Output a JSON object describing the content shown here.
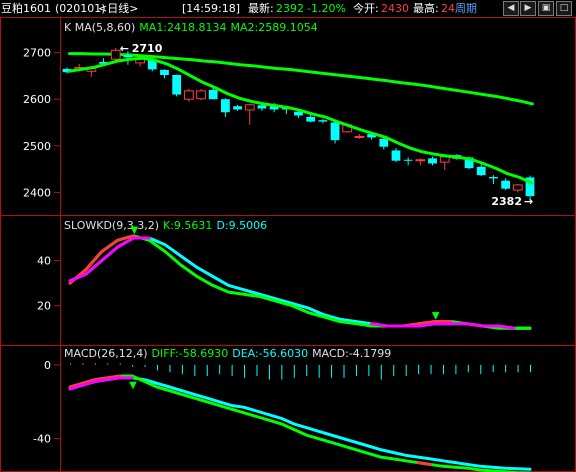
{
  "header": {
    "symbol": "豆粕1601",
    "code": "(020101)",
    "period": "<日线>",
    "time": "[14:59:18]",
    "last_label": "最新:",
    "last_value": "2392",
    "change_pct": "-1.20%",
    "open_label": "今开:",
    "open_value": "2430",
    "high_label": "最高:",
    "high_value": "24",
    "period_button": "周期",
    "icons": [
      "arrow-left-icon",
      "arrow-right-icon",
      "window-icon",
      "maximize-icon"
    ]
  },
  "colors": {
    "background": "#000000",
    "frame": "#b01010",
    "up": "#ff3c3c",
    "down": "#00ffff",
    "ma": "#00ff00",
    "white": "#ffffff",
    "magenta": "#ff00ff",
    "yellow": "#ffff00",
    "axis_text": "#ffffff",
    "title_white": "#e0e0e0",
    "green_text": "#00ff00",
    "cyan_text": "#00ffff"
  },
  "chart_data": [
    {
      "type": "candlestick",
      "title": "K  MA(5,8,60)",
      "legend": [
        {
          "label": "MA1:2418.8134",
          "color": "#00ff00"
        },
        {
          "label": "MA2:2589.1054",
          "color": "#00ff00"
        }
      ],
      "ylim": [
        2360,
        2740
      ],
      "yticks": [
        2400,
        2500,
        2600,
        2700
      ],
      "high_marker": {
        "label": "2710",
        "value": 2710
      },
      "low_marker": {
        "label": "2382",
        "value": 2382
      },
      "candles": [
        {
          "o": 2665,
          "h": 2668,
          "l": 2655,
          "c": 2658
        },
        {
          "o": 2665,
          "h": 2676,
          "l": 2660,
          "c": 2668
        },
        {
          "o": 2660,
          "h": 2672,
          "l": 2648,
          "c": 2667
        },
        {
          "o": 2680,
          "h": 2688,
          "l": 2672,
          "c": 2676
        },
        {
          "o": 2686,
          "h": 2710,
          "l": 2680,
          "c": 2705
        },
        {
          "o": 2694,
          "h": 2703,
          "l": 2674,
          "c": 2690
        },
        {
          "o": 2678,
          "h": 2690,
          "l": 2670,
          "c": 2686
        },
        {
          "o": 2685,
          "h": 2688,
          "l": 2660,
          "c": 2664
        },
        {
          "o": 2663,
          "h": 2664,
          "l": 2645,
          "c": 2652
        },
        {
          "o": 2652,
          "h": 2653,
          "l": 2606,
          "c": 2610
        },
        {
          "o": 2600,
          "h": 2622,
          "l": 2595,
          "c": 2618
        },
        {
          "o": 2601,
          "h": 2622,
          "l": 2598,
          "c": 2618
        },
        {
          "o": 2620,
          "h": 2625,
          "l": 2600,
          "c": 2600
        },
        {
          "o": 2600,
          "h": 2602,
          "l": 2562,
          "c": 2572
        },
        {
          "o": 2585,
          "h": 2588,
          "l": 2575,
          "c": 2578
        },
        {
          "o": 2577,
          "h": 2590,
          "l": 2545,
          "c": 2588
        },
        {
          "o": 2587,
          "h": 2590,
          "l": 2575,
          "c": 2580
        },
        {
          "o": 2585,
          "h": 2592,
          "l": 2572,
          "c": 2578
        },
        {
          "o": 2582,
          "h": 2585,
          "l": 2568,
          "c": 2578
        },
        {
          "o": 2573,
          "h": 2580,
          "l": 2560,
          "c": 2565
        },
        {
          "o": 2562,
          "h": 2566,
          "l": 2550,
          "c": 2552
        },
        {
          "o": 2555,
          "h": 2558,
          "l": 2548,
          "c": 2552
        },
        {
          "o": 2550,
          "h": 2555,
          "l": 2505,
          "c": 2512
        },
        {
          "o": 2530,
          "h": 2548,
          "l": 2528,
          "c": 2545
        },
        {
          "o": 2518,
          "h": 2525,
          "l": 2515,
          "c": 2520
        },
        {
          "o": 2525,
          "h": 2527,
          "l": 2513,
          "c": 2518
        },
        {
          "o": 2515,
          "h": 2518,
          "l": 2492,
          "c": 2498
        },
        {
          "o": 2490,
          "h": 2495,
          "l": 2465,
          "c": 2468
        },
        {
          "o": 2470,
          "h": 2475,
          "l": 2458,
          "c": 2468
        },
        {
          "o": 2470,
          "h": 2473,
          "l": 2458,
          "c": 2470
        },
        {
          "o": 2473,
          "h": 2477,
          "l": 2458,
          "c": 2462
        },
        {
          "o": 2465,
          "h": 2478,
          "l": 2448,
          "c": 2476
        },
        {
          "o": 2480,
          "h": 2482,
          "l": 2470,
          "c": 2472
        },
        {
          "o": 2475,
          "h": 2477,
          "l": 2450,
          "c": 2452
        },
        {
          "o": 2455,
          "h": 2460,
          "l": 2435,
          "c": 2437
        },
        {
          "o": 2433,
          "h": 2437,
          "l": 2418,
          "c": 2430
        },
        {
          "o": 2425,
          "h": 2430,
          "l": 2405,
          "c": 2408
        },
        {
          "o": 2405,
          "h": 2418,
          "l": 2400,
          "c": 2416
        },
        {
          "o": 2432,
          "h": 2436,
          "l": 2382,
          "c": 2392
        }
      ],
      "ma_fast": [
        2660,
        2664,
        2668,
        2675,
        2682,
        2686,
        2688,
        2684,
        2676,
        2664,
        2650,
        2636,
        2625,
        2612,
        2602,
        2595,
        2590,
        2586,
        2582,
        2576,
        2568,
        2562,
        2552,
        2543,
        2534,
        2526,
        2518,
        2506,
        2495,
        2487,
        2482,
        2478,
        2475,
        2471,
        2462,
        2452,
        2440,
        2432,
        2420
      ],
      "ma_slow": [
        2698,
        2698,
        2697,
        2697,
        2696,
        2695,
        2693,
        2691,
        2689,
        2687,
        2685,
        2682,
        2680,
        2677,
        2674,
        2672,
        2669,
        2666,
        2664,
        2661,
        2658,
        2655,
        2652,
        2649,
        2646,
        2643,
        2640,
        2636,
        2633,
        2630,
        2626,
        2622,
        2618,
        2614,
        2610,
        2606,
        2601,
        2596,
        2590
      ]
    },
    {
      "type": "line",
      "title": "SLOWKD(9,3,3,2)",
      "legend": [
        {
          "label": "K:9.5631",
          "color": "#00ff00"
        },
        {
          "label": "D:9.5006",
          "color": "#00ffff"
        }
      ],
      "ylim": [
        3,
        58
      ],
      "yticks": [
        20,
        40
      ],
      "k": [
        30,
        36,
        44,
        49,
        51,
        49,
        44,
        38,
        33,
        29,
        26,
        25,
        24,
        22,
        20,
        17,
        15,
        13,
        12,
        11,
        11,
        11,
        12,
        13,
        13,
        12,
        11,
        10,
        10,
        10
      ],
      "d": [
        31,
        34,
        40,
        46,
        50,
        50,
        47,
        42,
        37,
        33,
        29,
        27,
        25,
        23,
        21,
        19,
        16,
        14,
        13,
        12,
        11,
        11,
        11,
        12,
        12,
        12,
        11,
        11,
        10,
        10
      ]
    },
    {
      "type": "bar_line",
      "title": "MACD(26,12,4)",
      "legend": [
        {
          "label": "DIFF:-58.6930",
          "color": "#00ff00"
        },
        {
          "label": "DEA:-56.6030",
          "color": "#00ffff"
        },
        {
          "label": "MACD:-4.1799",
          "color": "#e0e0e0"
        }
      ],
      "ylim": [
        -57,
        7
      ],
      "yticks": [
        0,
        -40
      ],
      "diff": [
        -12,
        -10,
        -8,
        -7,
        -6,
        -6,
        -9,
        -12,
        -14,
        -16,
        -18,
        -20,
        -22,
        -24,
        -26,
        -28,
        -30,
        -32,
        -35,
        -38,
        -40,
        -42,
        -44,
        -46,
        -48,
        -50,
        -51,
        -52,
        -53,
        -54,
        -55,
        -55.5,
        -56,
        -57,
        -57.5,
        -58,
        -58.5,
        -58.7
      ],
      "dea": [
        -13,
        -11,
        -9,
        -8,
        -7,
        -7,
        -8,
        -10,
        -12,
        -14,
        -16,
        -18,
        -20,
        -22,
        -23,
        -25,
        -27,
        -29,
        -32,
        -34,
        -36,
        -38,
        -40,
        -42,
        -44,
        -46,
        -47.5,
        -49,
        -50,
        -51,
        -52,
        -53,
        -54,
        -55,
        -55.5,
        -56,
        -56.3,
        -56.6
      ],
      "macd": [
        1,
        1,
        1,
        1,
        1,
        -1,
        -1,
        -3,
        -4,
        -5,
        -6,
        -6,
        -5,
        -6,
        -7,
        -6,
        -8,
        -8,
        -7,
        -6,
        -7,
        -7,
        -7,
        -6,
        -6,
        -8,
        -6,
        -6,
        -5,
        -5,
        -5,
        -5,
        -4,
        -5,
        -4,
        -4,
        -4,
        -4
      ]
    }
  ]
}
